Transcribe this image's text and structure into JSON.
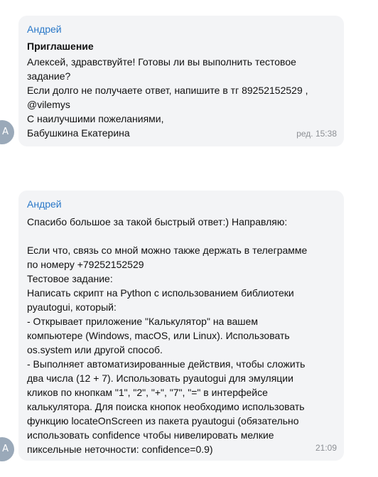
{
  "messages": [
    {
      "avatar_letter": "А",
      "sender": "Андрей",
      "subject": "Приглашение",
      "lines": [
        "Алексей, здравствуйте! Готовы ли вы выполнить тестовое",
        "задание?",
        "Если долго не получаете ответ, напишите в тг 89252152529 ,",
        "@vilemys",
        "С наилучшими пожеланиями,",
        "Бабушкина Екатерина"
      ],
      "meta": "ред. 15:38"
    },
    {
      "avatar_letter": "А",
      "sender": "Андрей",
      "lines": [
        "Спасибо большое за такой быстрый ответ:) Направляю:",
        "",
        "Если что, связь со мной можно также держать в телеграмме",
        "по номеру +79252152529",
        "Тестовое задание:",
        "Написать скрипт на Python с использованием библиотеки",
        "pyautogui, который:",
        "- Открывает приложение \"Калькулятор\" на вашем",
        "компьютере (Windows, macOS, или Linux). Использовать",
        "os.system или другой способ.",
        "- Выполняет автоматизированные действия, чтобы сложить",
        "два числа (12 + 7). Использовать pyautogui для эмуляции",
        "кликов по кнопкам \"1\", \"2\", \"+\", \"7\", \"=\" в интерфейсе",
        "калькулятора. Для поиска кнопок необходимо использовать",
        "функцию locateOnScreen из пакета pyautogui (обязательно",
        "использовать confidence чтобы нивелировать мелкие",
        "пиксельные неточности: confidence=0.9)"
      ],
      "meta": "21:09"
    }
  ]
}
